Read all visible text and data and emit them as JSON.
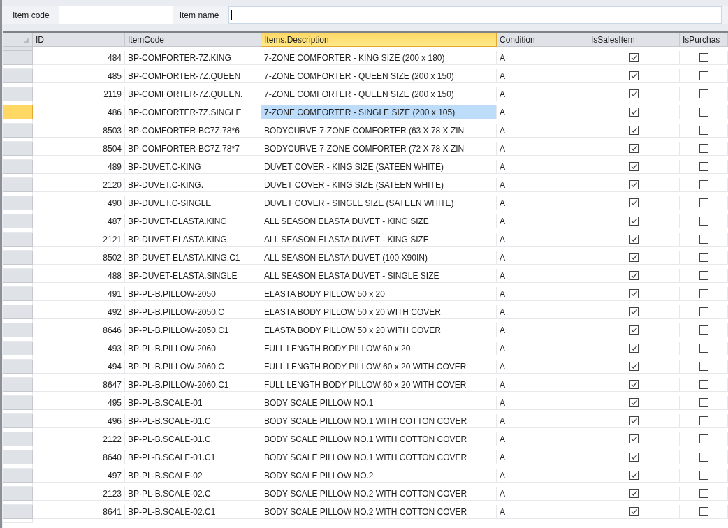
{
  "filters": [
    {
      "label": "Item code",
      "focused": false
    },
    {
      "label": "Item name",
      "focused": true
    }
  ],
  "table": {
    "columns": [
      {
        "label": "ID",
        "kind": "number",
        "selected": false
      },
      {
        "label": "ItemCode",
        "kind": "text",
        "selected": false
      },
      {
        "label": "Items.Description",
        "kind": "text",
        "selected": true
      },
      {
        "label": "Condition",
        "kind": "text",
        "selected": false
      },
      {
        "label": "IsSalesItem",
        "kind": "check",
        "selected": false
      },
      {
        "label": "IsPurchas",
        "kind": "check",
        "selected": false
      }
    ],
    "rows": [
      {
        "selected": false,
        "cells": [
          "484",
          "BP-COMFORTER-7Z.KING",
          "7-ZONE COMFORTER - KING SIZE (200 x 180)",
          "A",
          true,
          false
        ]
      },
      {
        "selected": false,
        "cells": [
          "485",
          "BP-COMFORTER-7Z.QUEEN",
          "7-ZONE COMFORTER - QUEEN SIZE (200 x 150)",
          "A",
          true,
          false
        ]
      },
      {
        "selected": false,
        "cells": [
          "2119",
          "BP-COMFORTER-7Z.QUEEN.",
          "7-ZONE COMFORTER - QUEEN SIZE (200 x 150)",
          "A",
          true,
          false
        ]
      },
      {
        "selected": true,
        "cells": [
          "486",
          "BP-COMFORTER-7Z.SINGLE",
          "7-ZONE COMFORTER - SINGLE SIZE (200 x 105)",
          "A",
          true,
          false
        ]
      },
      {
        "selected": false,
        "cells": [
          "8503",
          "BP-COMFORTER-BC7Z.78*6",
          "BODYCURVE 7-ZONE COMFORTER (63 X 78 X ZIN",
          "A",
          true,
          false
        ]
      },
      {
        "selected": false,
        "cells": [
          "8504",
          "BP-COMFORTER-BC7Z.78*7",
          "BODYCURVE 7-ZONE COMFORTER (72 X 78 X ZIN",
          "A",
          true,
          false
        ]
      },
      {
        "selected": false,
        "cells": [
          "489",
          "BP-DUVET.C-KING",
          "DUVET COVER - KING SIZE (SATEEN WHITE)",
          "A",
          true,
          false
        ]
      },
      {
        "selected": false,
        "cells": [
          "2120",
          "BP-DUVET.C-KING.",
          "DUVET COVER - KING SIZE (SATEEN WHITE)",
          "A",
          true,
          false
        ]
      },
      {
        "selected": false,
        "cells": [
          "490",
          "BP-DUVET.C-SINGLE",
          "DUVET COVER - SINGLE SIZE (SATEEN WHITE)",
          "A",
          true,
          false
        ]
      },
      {
        "selected": false,
        "cells": [
          "487",
          "BP-DUVET-ELASTA.KING",
          "ALL SEASON ELASTA DUVET - KING SIZE",
          "A",
          true,
          false
        ]
      },
      {
        "selected": false,
        "cells": [
          "2121",
          "BP-DUVET-ELASTA.KING.",
          "ALL SEASON ELASTA DUVET - KING SIZE",
          "A",
          true,
          false
        ]
      },
      {
        "selected": false,
        "cells": [
          "8502",
          "BP-DUVET-ELASTA.KING.C1",
          "ALL SEASON ELASTA DUVET (100 X90IN)",
          "A",
          true,
          false
        ]
      },
      {
        "selected": false,
        "cells": [
          "488",
          "BP-DUVET-ELASTA.SINGLE",
          "ALL SEASON ELASTA DUVET - SINGLE SIZE",
          "A",
          true,
          false
        ]
      },
      {
        "selected": false,
        "cells": [
          "491",
          "BP-PL-B.PILLOW-2050",
          "ELASTA BODY PILLOW 50 x 20",
          "A",
          true,
          false
        ]
      },
      {
        "selected": false,
        "cells": [
          "492",
          "BP-PL-B.PILLOW-2050.C",
          "ELASTA BODY PILLOW 50 x 20 WITH COVER",
          "A",
          true,
          false
        ]
      },
      {
        "selected": false,
        "cells": [
          "8646",
          "BP-PL-B.PILLOW-2050.C1",
          "ELASTA BODY PILLOW 50 x 20 WITH COVER",
          "A",
          true,
          false
        ]
      },
      {
        "selected": false,
        "cells": [
          "493",
          "BP-PL-B.PILLOW-2060",
          "FULL LENGTH BODY PILLOW 60 x 20",
          "A",
          true,
          false
        ]
      },
      {
        "selected": false,
        "cells": [
          "494",
          "BP-PL-B.PILLOW-2060.C",
          "FULL LENGTH BODY PILLOW 60 x 20 WITH COVER",
          "A",
          true,
          false
        ]
      },
      {
        "selected": false,
        "cells": [
          "8647",
          "BP-PL-B.PILLOW-2060.C1",
          "FULL LENGTH BODY PILLOW 60 x 20 WITH COVER",
          "A",
          true,
          false
        ]
      },
      {
        "selected": false,
        "cells": [
          "495",
          "BP-PL-B.SCALE-01",
          "BODY SCALE PILLOW NO.1",
          "A",
          true,
          false
        ]
      },
      {
        "selected": false,
        "cells": [
          "496",
          "BP-PL-B.SCALE-01.C",
          "BODY SCALE PILLOW NO.1 WITH COTTON COVER",
          "A",
          true,
          false
        ]
      },
      {
        "selected": false,
        "cells": [
          "2122",
          "BP-PL-B.SCALE-01.C.",
          "BODY SCALE PILLOW NO.1 WITH COTTON COVER",
          "A",
          true,
          false
        ]
      },
      {
        "selected": false,
        "cells": [
          "8640",
          "BP-PL-B.SCALE-01.C1",
          "BODY SCALE PILLOW NO.1 WITH COTTON COVER",
          "A",
          true,
          false
        ]
      },
      {
        "selected": false,
        "cells": [
          "497",
          "BP-PL-B.SCALE-02",
          "BODY SCALE PILLOW NO.2",
          "A",
          true,
          false
        ]
      },
      {
        "selected": false,
        "cells": [
          "2123",
          "BP-PL-B.SCALE-02.C",
          "BODY SCALE PILLOW NO.2 WITH COTTON COVER",
          "A",
          true,
          false
        ]
      },
      {
        "selected": false,
        "cells": [
          "8641",
          "BP-PL-B.SCALE-02.C1",
          "BODY SCALE PILLOW NO.2 WITH COTTON COVER",
          "A",
          true,
          false
        ]
      }
    ]
  }
}
